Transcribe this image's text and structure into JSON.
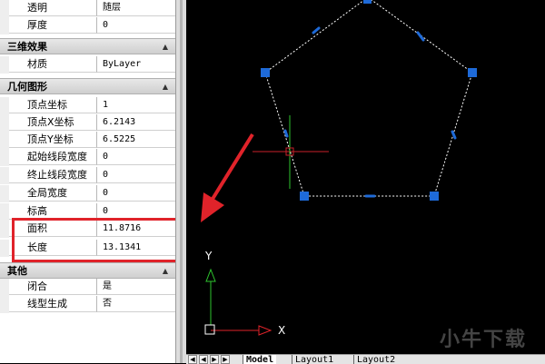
{
  "properties": {
    "top_rows": [
      {
        "label": "透明",
        "value": "随层"
      },
      {
        "label": "厚度",
        "value": "0"
      }
    ],
    "section_3d": {
      "title": "三维效果",
      "rows": [
        {
          "label": "材质",
          "value": "ByLayer"
        }
      ]
    },
    "section_geometry": {
      "title": "几何图形",
      "rows": [
        {
          "label": "顶点坐标",
          "value": "1"
        },
        {
          "label": "顶点X坐标",
          "value": "6.2143"
        },
        {
          "label": "顶点Y坐标",
          "value": "6.5225"
        },
        {
          "label": "起始线段宽度",
          "value": "0"
        },
        {
          "label": "终止线段宽度",
          "value": "0"
        },
        {
          "label": "全局宽度",
          "value": "0"
        },
        {
          "label": "标高",
          "value": "0"
        },
        {
          "label": "面积",
          "value": "11.8716"
        },
        {
          "label": "长度",
          "value": "13.1341"
        }
      ]
    },
    "section_other": {
      "title": "其他",
      "rows": [
        {
          "label": "闭合",
          "value": "是"
        },
        {
          "label": "线型生成",
          "value": "否"
        }
      ]
    },
    "collapse_glyph": "▲"
  },
  "ucs": {
    "x_label": "X",
    "y_label": "Y"
  },
  "tabs": {
    "nav": [
      "◀",
      "◀",
      "▶",
      "▶"
    ],
    "items": [
      "Model",
      "Layout1",
      "Layout2"
    ]
  },
  "watermark": "小牛下载",
  "colors": {
    "highlight": "#e0232a",
    "grip": "#1e6ad8",
    "arrow": "#e0232a",
    "ucs_x": "#e0232a",
    "ucs_y": "#2ec52e"
  }
}
